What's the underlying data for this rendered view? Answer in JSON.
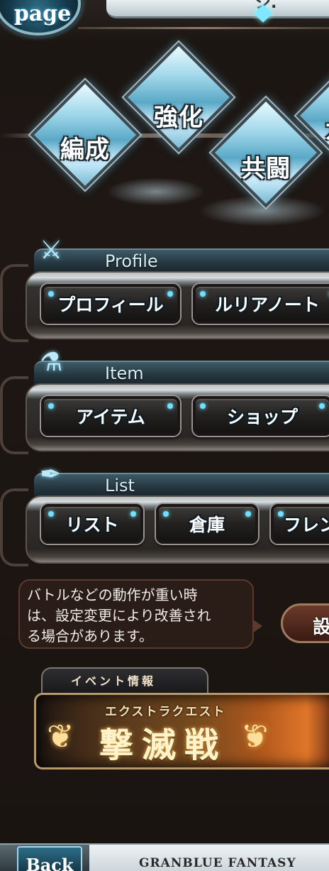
{
  "header": {
    "mypage_label": "page",
    "top_bar_glyph": "ジ."
  },
  "crystal_menu": [
    {
      "label": "編成"
    },
    {
      "label": "強化"
    },
    {
      "label": "共闘"
    },
    {
      "label": "ガ"
    }
  ],
  "sections": {
    "profile": {
      "title": "Profile",
      "buttons": [
        "プロフィール",
        "ルリアノート"
      ]
    },
    "item": {
      "title": "Item",
      "buttons": [
        "アイテム",
        "ショップ"
      ]
    },
    "list": {
      "title": "List",
      "buttons": [
        "リスト",
        "倉庫",
        "フレン"
      ]
    }
  },
  "tip": {
    "line1": "バトルなどの動作が重い時",
    "line2": "は、設定変更により改善され",
    "line3": "る場合があります。"
  },
  "settings_button": {
    "label": "設"
  },
  "event": {
    "tab_label": "イベント情報",
    "subtitle": "エクストラクエスト",
    "title": "撃滅戦"
  },
  "footer": {
    "back_label": "Back",
    "logo_text": "GRANBLUE FANTASY"
  },
  "colors": {
    "background": "#1a1411",
    "accent_glow": "#6fe0ff",
    "tip_bg": "#2a1d17"
  }
}
